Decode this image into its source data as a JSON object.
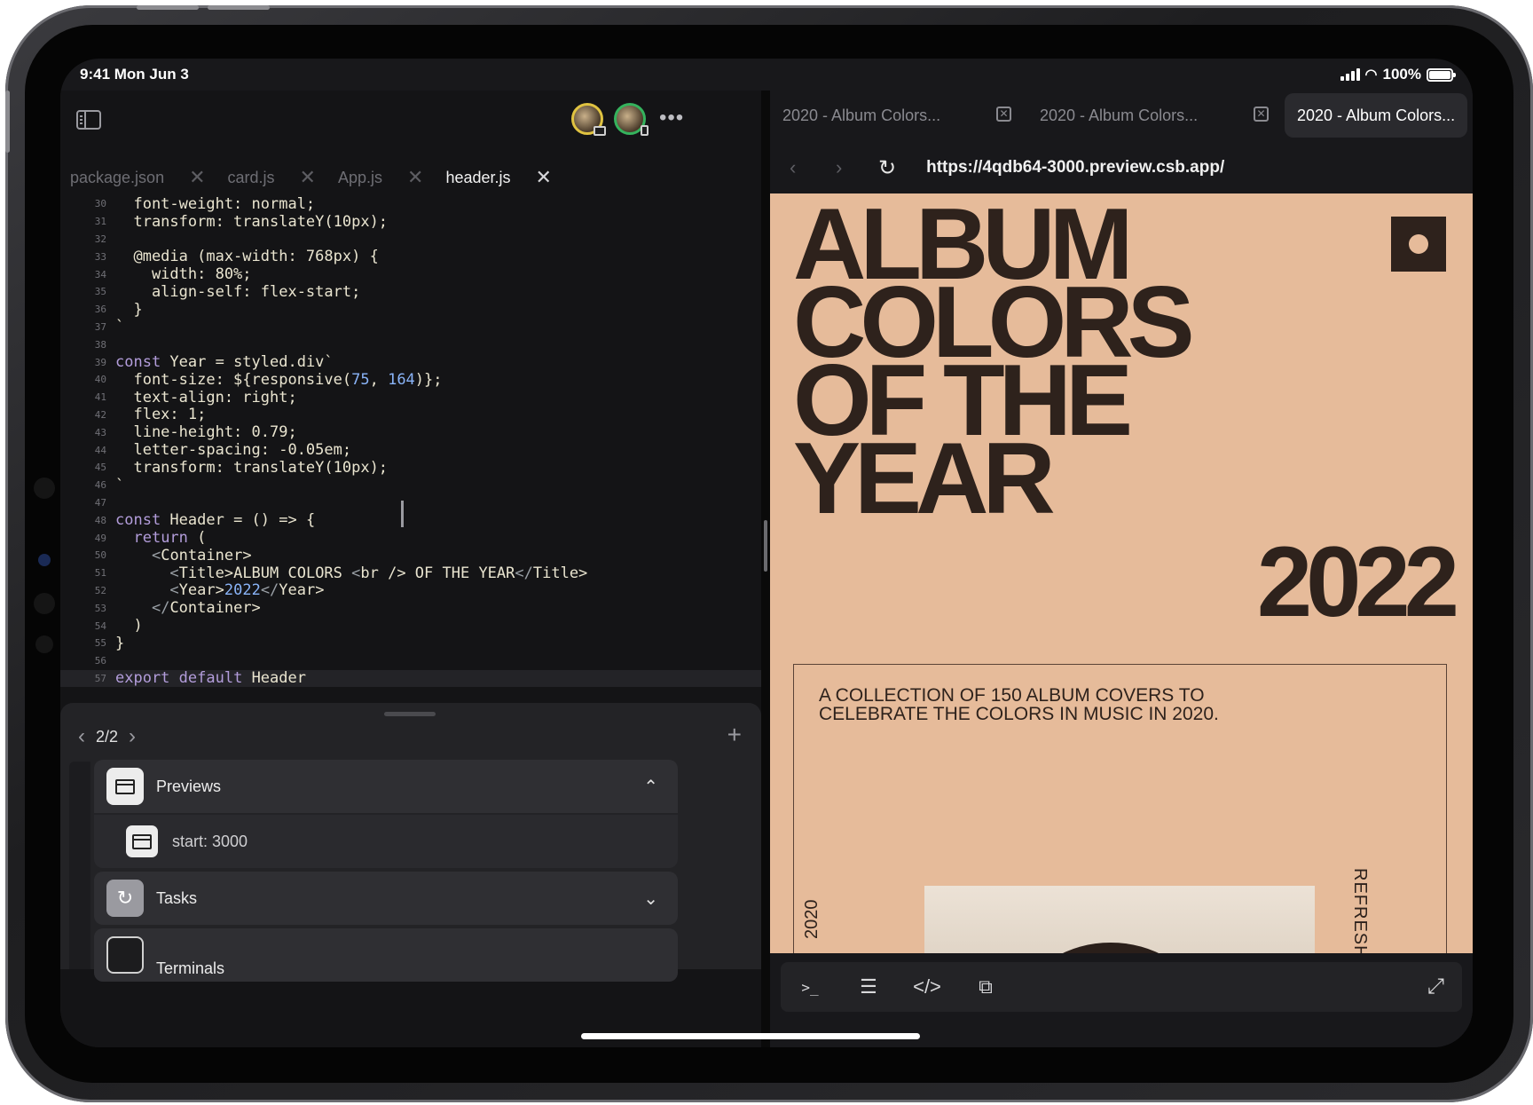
{
  "status_bar": {
    "time": "9:41  Mon Jun 3",
    "battery": "100%"
  },
  "editor": {
    "icons": {
      "sidebar": "sidebar-toggle-icon",
      "more": "ellipsis-icon"
    },
    "collaborators": [
      {
        "ring_color": "#e0c341",
        "device": "desktop"
      },
      {
        "ring_color": "#35b35d",
        "device": "tablet"
      }
    ],
    "tabs": [
      {
        "label": "package.json",
        "active": false
      },
      {
        "label": "card.js",
        "active": false
      },
      {
        "label": "App.js",
        "active": false
      },
      {
        "label": "header.js",
        "active": true
      }
    ],
    "lines": [
      {
        "n": "30",
        "text": "  font-weight: normal;"
      },
      {
        "n": "31",
        "text": "  transform: translateY(10px);"
      },
      {
        "n": "32",
        "text": ""
      },
      {
        "n": "33",
        "text": "  @media (max-width: 768px) {"
      },
      {
        "n": "34",
        "text": "    width: 80%;"
      },
      {
        "n": "35",
        "text": "    align-self: flex-start;"
      },
      {
        "n": "36",
        "text": "  }"
      },
      {
        "n": "37",
        "text": "`"
      },
      {
        "n": "38",
        "text": ""
      },
      {
        "n": "39",
        "text": "const Year = styled.div`"
      },
      {
        "n": "40",
        "text": "  font-size: ${responsive(75, 164)};"
      },
      {
        "n": "41",
        "text": "  text-align: right;"
      },
      {
        "n": "42",
        "text": "  flex: 1;"
      },
      {
        "n": "43",
        "text": "  line-height: 0.79;"
      },
      {
        "n": "44",
        "text": "  letter-spacing: -0.05em;"
      },
      {
        "n": "45",
        "text": "  transform: translateY(10px);"
      },
      {
        "n": "46",
        "text": "`"
      },
      {
        "n": "47",
        "text": ""
      },
      {
        "n": "48",
        "text": "const Header = () => {"
      },
      {
        "n": "49",
        "text": "  return ("
      },
      {
        "n": "50",
        "text": "    <Container>"
      },
      {
        "n": "51",
        "text": "      <Title>ALBUM COLORS <br /> OF THE YEAR</Title>"
      },
      {
        "n": "52",
        "text": "      <Year>2022</Year>"
      },
      {
        "n": "53",
        "text": "    </Container>"
      },
      {
        "n": "54",
        "text": "  )"
      },
      {
        "n": "55",
        "text": "}"
      },
      {
        "n": "56",
        "text": ""
      },
      {
        "n": "57",
        "text": "export default Header"
      }
    ],
    "current_line": "57"
  },
  "panel": {
    "pager": "2/2",
    "icons": {
      "prev": "chevron-left-icon",
      "next": "chevron-right-icon",
      "add": "plus-icon"
    },
    "sections": {
      "previews": {
        "label": "Previews",
        "icon": "window-icon",
        "expanded": true
      },
      "previews_item": {
        "label": "start: 3000",
        "icon": "window-icon"
      },
      "tasks": {
        "label": "Tasks",
        "icon": "refresh-icon",
        "expanded": false
      },
      "terminals": {
        "label": "Terminals",
        "icon": "terminal-icon"
      }
    }
  },
  "browser": {
    "tabs": [
      {
        "label": "2020 - Album Colors...",
        "active": false
      },
      {
        "label": "2020 - Album Colors...",
        "active": false
      },
      {
        "label": "2020 - Album Colors...",
        "active": true
      }
    ],
    "url": "https://4qdb64-3000.preview.csb.app/",
    "icons": {
      "back": "chevron-left-icon",
      "forward": "chevron-right-icon",
      "reload": "reload-icon"
    },
    "page": {
      "title": "ALBUM\nCOLORS\nOF THE\nYEAR",
      "year": "2022",
      "description": "A COLLECTION OF 150 ALBUM COVERS TO CELEBRATE THE COLORS IN MUSIC IN 2020.",
      "side_left": "2020",
      "side_right": "REFRESH",
      "background": "#e6bb9a",
      "ink": "#2e221c"
    },
    "toolbar": {
      "icons": [
        "terminal-icon",
        "list-icon",
        "code-icon",
        "layers-icon"
      ],
      "expand": "expand-icon"
    }
  }
}
